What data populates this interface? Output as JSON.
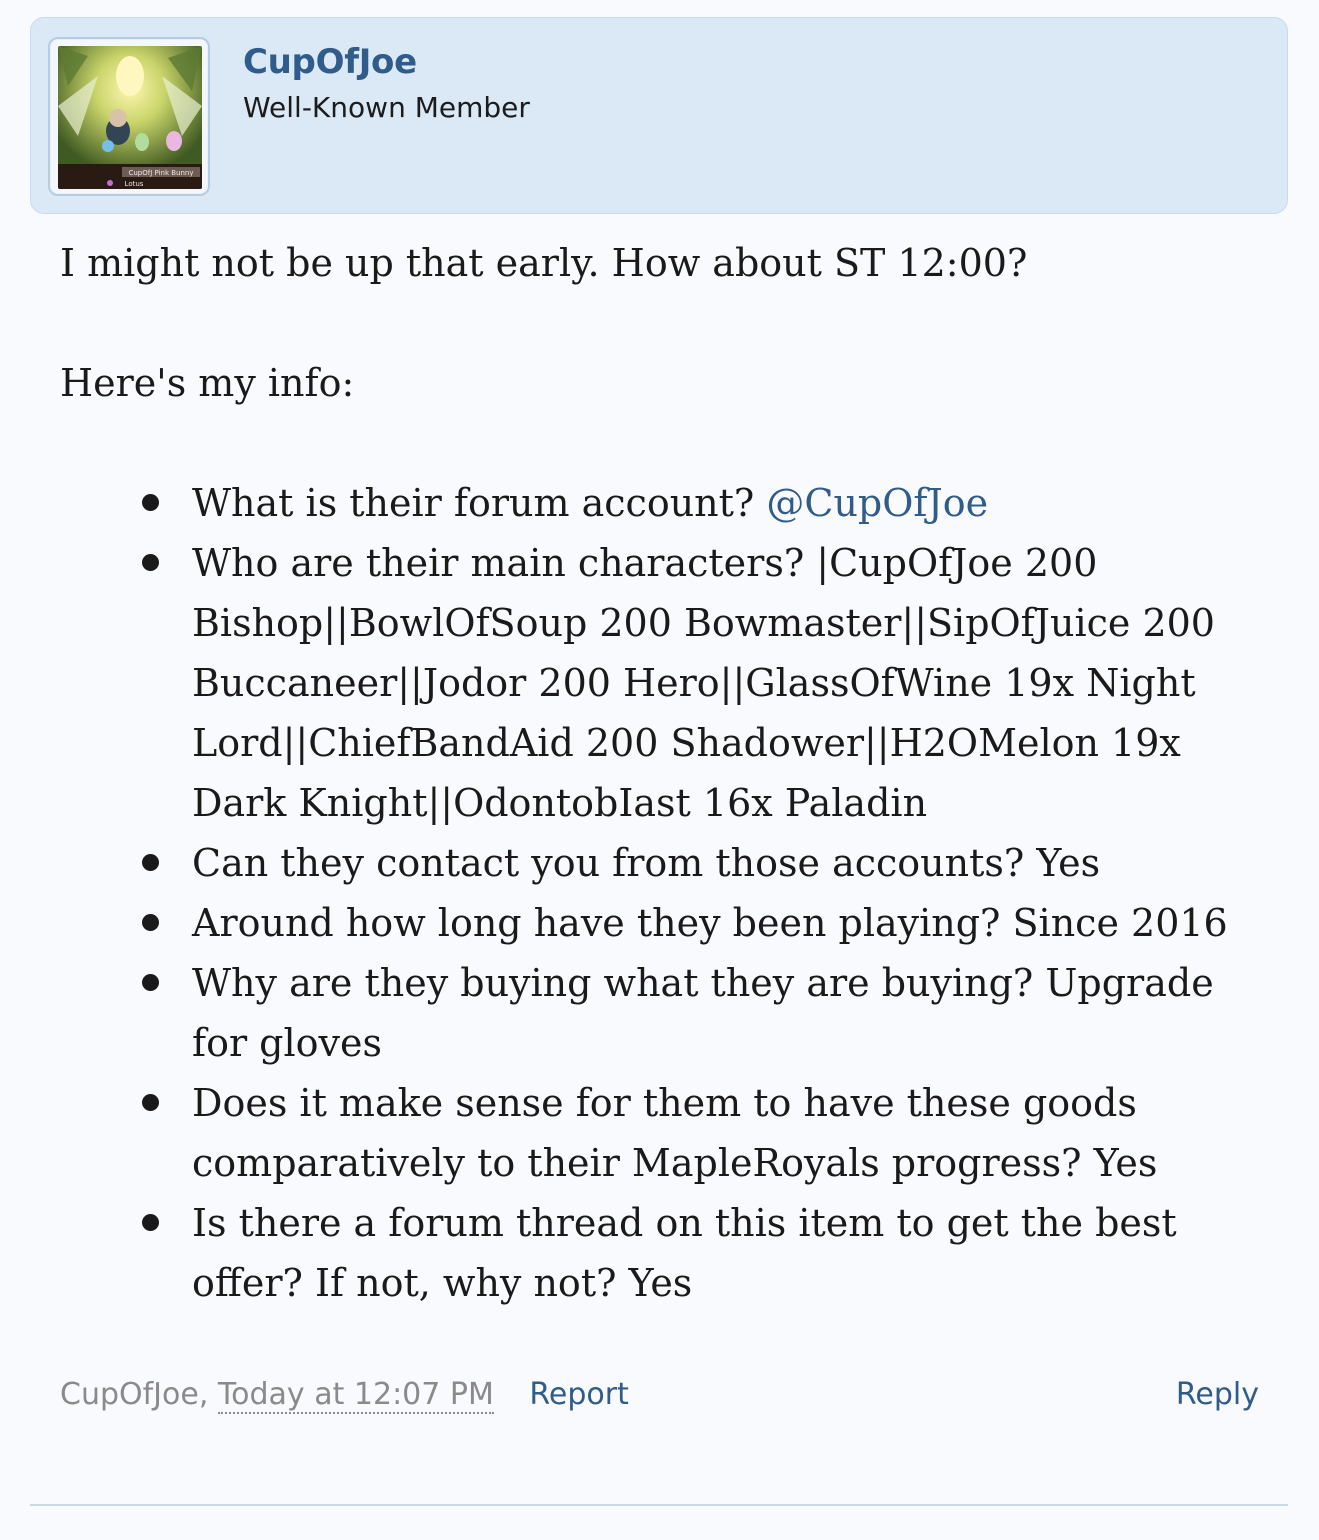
{
  "post": {
    "author": {
      "username": "CupOfJoe",
      "user_title": "Well-Known Member",
      "avatar_caption": "CupOfJ Pink Bunny",
      "avatar_guild": "Lotus"
    },
    "message": {
      "line1": "I might not be up that early. How about ST 12:00?",
      "line2": "Here's my info:",
      "items": [
        {
          "question": "What is their forum account? ",
          "mention": "@CupOfJoe"
        },
        {
          "text": "Who are their main characters? |CupOfJoe 200 Bishop||BowlOfSoup 200 Bowmaster||SipOfJuice 200 Buccaneer||Jodor 200 Hero||GlassOfWine 19x Night Lord||ChiefBandAid 200 Shadower||H2OMelon 19x Dark Knight||OdontobIast 16x Paladin"
        },
        {
          "text": "Can they contact you from those accounts? Yes"
        },
        {
          "text": "Around how long have they been playing? Since 2016"
        },
        {
          "text": "Why are they buying what they are buying? Upgrade for gloves"
        },
        {
          "text": "Does it make sense for them to have these goods comparatively to their MapleRoyals progress? Yes"
        },
        {
          "text": "Is there a forum thread on this item to get the best offer? If not, why not? Yes"
        }
      ]
    },
    "footer": {
      "author": "CupOfJoe,",
      "time": "Today at 12:07 PM",
      "report_label": "Report",
      "reply_label": "Reply"
    }
  },
  "colors": {
    "header_bg": "#dbe9f7",
    "link": "#2f5c8a",
    "muted": "#8a8a8a",
    "page_bg": "#f9fafd"
  }
}
